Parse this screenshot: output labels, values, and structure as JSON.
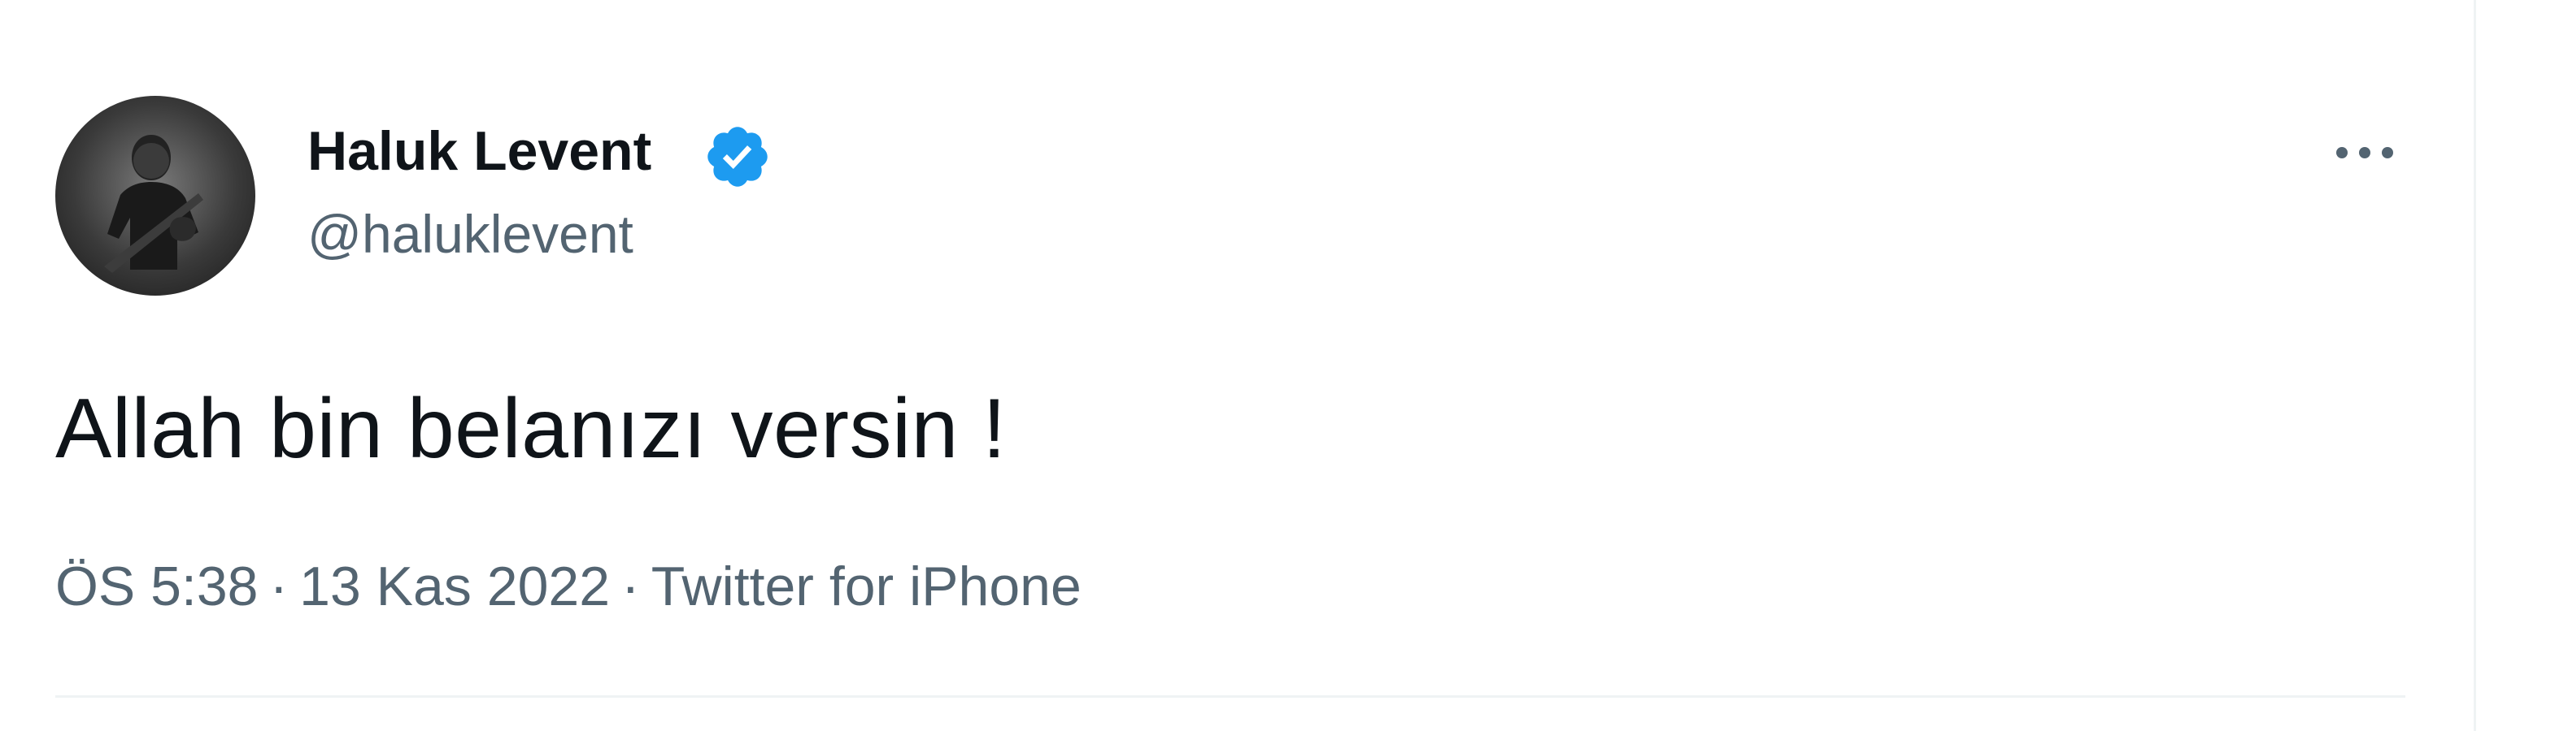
{
  "tweet": {
    "author": {
      "display_name": "Haluk Levent",
      "handle": "@haluklevent",
      "verified_icon": "verified-badge-icon",
      "avatar_icon": "avatar-photo"
    },
    "text": "Allah bin belanızı versin !",
    "meta": {
      "time": "ÖS 5:38",
      "separator": "·",
      "date": "13 Kas 2022",
      "source": "Twitter for iPhone"
    },
    "more_icon": "more-options-icon"
  },
  "colors": {
    "verified": "#1d9bf0",
    "primary_text": "#0f1419",
    "secondary_text": "#536471",
    "border": "#eff3f4"
  }
}
